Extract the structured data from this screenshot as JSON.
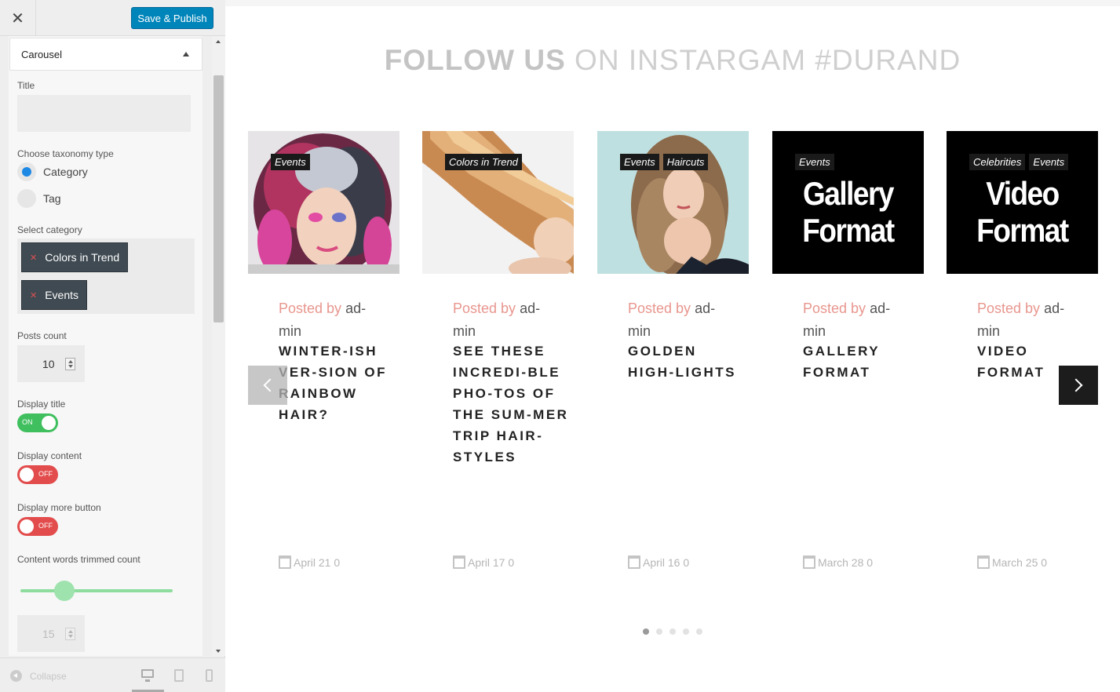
{
  "header": {
    "close_label": "✕",
    "publish_label": "Save & Publish"
  },
  "panel": {
    "section_title": "Carousel",
    "title_label": "Title",
    "title_value": "",
    "taxonomy_label": "Choose taxonomy type",
    "taxonomy_options": [
      "Category",
      "Tag"
    ],
    "taxonomy_selected": "Category",
    "category_label": "Select category",
    "categories": [
      "Colors in Trend",
      "Events"
    ],
    "posts_count_label": "Posts count",
    "posts_count": "10",
    "display_title_label": "Display title",
    "display_title": "ON",
    "display_content_label": "Display content",
    "display_content": "OFF",
    "display_more_label": "Display more button",
    "display_more": "OFF",
    "trim_label": "Content words trimmed count",
    "trim_value": "15",
    "trim_slider_fraction": 0.29
  },
  "footer": {
    "collapse_label": "Collapse"
  },
  "main": {
    "heading_bold": "FOLLOW US",
    "heading_rest": " ON INSTARGAM #DURAND",
    "cards": [
      {
        "tags": [
          "Events"
        ],
        "thumb_text": "",
        "posted_by": "Posted by",
        "author": "ad-min",
        "title": "WINTER-ISH VER-SION OF RAINBOW HAIR?",
        "date": "April 21 0"
      },
      {
        "tags": [
          "Colors in Trend"
        ],
        "thumb_text": "",
        "posted_by": "Posted by",
        "author": "ad-min",
        "title": "SEE THESE INCREDI-BLE PHO-TOS OF THE SUM-MER TRIP HAIR-STYLES",
        "date": "April 17 0"
      },
      {
        "tags": [
          "Events",
          "Haircuts"
        ],
        "thumb_text": "",
        "posted_by": "Posted by",
        "author": "ad-min",
        "title": "GOLDEN HIGH-LIGHTS",
        "date": "April 16 0"
      },
      {
        "tags": [
          "Events"
        ],
        "thumb_text": "Gallery Format",
        "posted_by": "Posted by",
        "author": "ad-min",
        "title": "GALLERY FORMAT",
        "date": "March 28 0"
      },
      {
        "tags": [
          "Celebrities",
          "Events"
        ],
        "thumb_text": "Video Format",
        "posted_by": "Posted by",
        "author": "ad-min",
        "title": "VIDEO FORMAT",
        "date": "March 25 0"
      }
    ],
    "dots_total": 5,
    "dots_active": 1
  },
  "colors": {
    "accent": "#0085ba",
    "toggle_on": "#3fbf5e",
    "toggle_off": "#e34c4c",
    "posted_by": "#e8968e"
  }
}
